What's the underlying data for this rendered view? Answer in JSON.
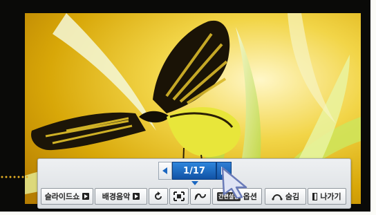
{
  "pager": {
    "current": "1/17",
    "prev_icon": "chevron-left-icon",
    "next_icon": "chevron-right-icon"
  },
  "toolbar": {
    "slideshow_label": "슬라이드쇼",
    "bgm_label": "배경음악",
    "rotate_icon": "rotate-icon",
    "fit_icon": "fit-screen-icon",
    "link_icon": "link-icon",
    "quick_settings_badge": "간편설정",
    "options_label": "옵션",
    "hide_label": "숨김",
    "exit_label": "나가기"
  },
  "colors": {
    "accent": "#1a67c1",
    "frame": "#0a0a08",
    "dots": "#e7b126"
  },
  "photo": {
    "subject_icon": "butterfly-image"
  }
}
